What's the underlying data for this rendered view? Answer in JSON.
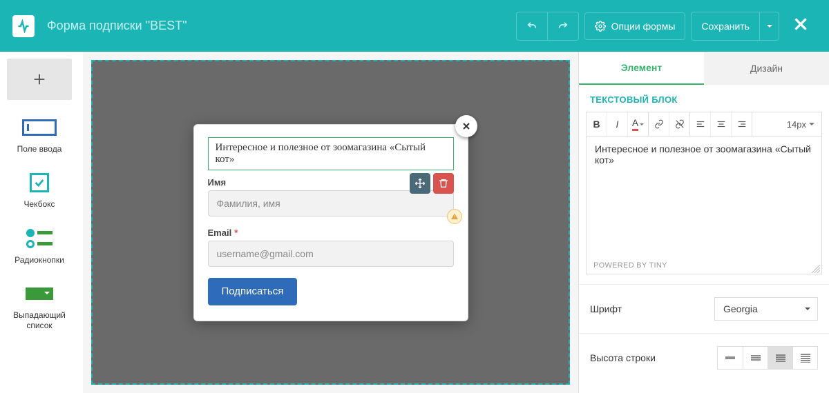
{
  "header": {
    "title": "Форма подписки \"BEST\"",
    "options_label": "Опции формы",
    "save_label": "Сохранить"
  },
  "sidebar": {
    "items": [
      {
        "label": "Поле ввода"
      },
      {
        "label": "Чекбокс"
      },
      {
        "label": "Радиокнопки"
      },
      {
        "label": "Выпадающий список"
      }
    ]
  },
  "form": {
    "heading": "Интересное и полезное от зоомагазина «Сытый кот»",
    "fields": {
      "name": {
        "label": "Имя",
        "placeholder": "Фамилия, имя",
        "required": false
      },
      "email": {
        "label": "Email",
        "placeholder": "username@gmail.com",
        "required": true
      }
    },
    "submit_label": "Подписаться"
  },
  "panel": {
    "tabs": {
      "element": "Элемент",
      "design": "Дизайн",
      "active": "element"
    },
    "section_title": "ТЕКСТОВЫЙ БЛОК",
    "editor": {
      "content": "Интересное и полезное от зоомагазина «Сытый кот»",
      "font_size_label": "14px",
      "powered_by": "POWERED BY TINY"
    },
    "settings": {
      "font": {
        "label": "Шрифт",
        "value": "Georgia"
      },
      "line_height": {
        "label": "Высота строки",
        "active_index": 2
      }
    }
  }
}
